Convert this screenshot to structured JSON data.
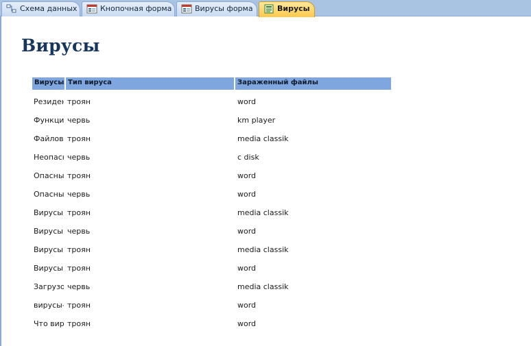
{
  "tabs": [
    {
      "label": "Схема данных",
      "icon": "relationships-icon"
    },
    {
      "label": "Кнопочная форма",
      "icon": "form-icon"
    },
    {
      "label": "Вирусы форма",
      "icon": "form-icon"
    },
    {
      "label": "Вирусы",
      "icon": "report-icon",
      "active": true
    }
  ],
  "report": {
    "title": "Вирусы",
    "columns": [
      "Вирусы",
      "Тип вируса",
      "Зараженный файлы"
    ],
    "rows": [
      [
        "Резидентные",
        "троян",
        "word"
      ],
      [
        "Функциональные",
        "червь",
        "km player"
      ],
      [
        "Файловые",
        "троян",
        "media classik"
      ],
      [
        "Неопасные",
        "червь",
        "c disk"
      ],
      [
        "Опасные",
        "троян",
        "word"
      ],
      [
        "Опасные",
        "червь",
        "word"
      ],
      [
        "Вирусы,",
        "троян",
        "media classik"
      ],
      [
        "Вирусы,",
        "червь",
        "word"
      ],
      [
        "Вирусы,",
        "троян",
        "media classik"
      ],
      [
        "Вирусы,",
        "троян",
        "word"
      ],
      [
        "Загрузочные",
        "червь",
        "media classik"
      ],
      [
        "вирусы-",
        "троян",
        "word"
      ],
      [
        "Что вирус",
        "троян",
        "word"
      ]
    ]
  },
  "colors": {
    "tab_strip": "#a9c3e3",
    "header_fill": "#7fa6de",
    "active_tab": "#f9c94c",
    "title": "#17365d"
  }
}
